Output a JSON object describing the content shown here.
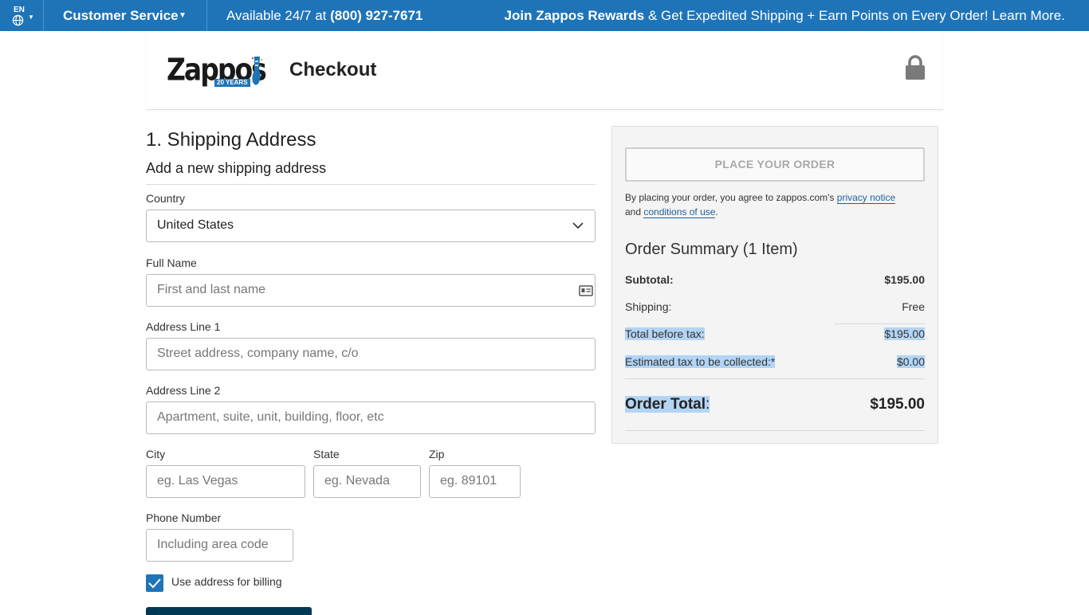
{
  "topbar": {
    "lang_code": "EN",
    "customer_service": "Customer Service",
    "available_prefix": "Available 24/7 at ",
    "phone": "(800) 927-7671",
    "rewards_bold": "Join Zappos Rewards",
    "rewards_rest": " & Get Expedited Shipping + Earn Points on Every Order! Learn More."
  },
  "header": {
    "logo_text": "Zappos",
    "logo_badge": "20 YEARS",
    "title": "Checkout"
  },
  "form": {
    "section_title": "1. Shipping Address",
    "subtitle": "Add a new shipping address",
    "country_label": "Country",
    "country_value": "United States",
    "fullname_label": "Full Name",
    "fullname_placeholder": "First and last name",
    "address1_label": "Address Line 1",
    "address1_placeholder": "Street address, company name, c/o",
    "address2_label": "Address Line 2",
    "address2_placeholder": "Apartment, suite, unit, building, floor, etc",
    "city_label": "City",
    "city_placeholder": "eg. Las Vegas",
    "state_label": "State",
    "state_placeholder": "eg. Nevada",
    "zip_label": "Zip",
    "zip_placeholder": "eg. 89101",
    "phone_label": "Phone Number",
    "phone_placeholder": "Including area code",
    "billing_checkbox_label": "Use address for billing",
    "billing_checked": true
  },
  "summary": {
    "place_order": "PLACE YOUR ORDER",
    "agree_text": "By placing your order, you agree to zappos.com's ",
    "privacy_link": "privacy notice",
    "agree_and": "and ",
    "conditions_link": "conditions of use",
    "agree_end": ".",
    "title": "Order Summary (1 Item)",
    "subtotal_label": "Subtotal:",
    "subtotal_value": "$195.00",
    "shipping_label": "Shipping:",
    "shipping_value": "Free",
    "before_tax_label": "Total before tax:",
    "before_tax_value": "$195.00",
    "tax_label": "Estimated tax to be collected:*",
    "tax_value": "$0.00",
    "order_total_label": "Order Total",
    "order_total_colon": ":",
    "order_total_value": "$195.00"
  },
  "colors": {
    "topbar_bg": "#1f74b8",
    "selection_highlight": "#b3d4f4",
    "checkbox": "#1f74b8"
  },
  "icons": [
    "globe-icon",
    "caret-down-icon",
    "shoe-icon",
    "lock-icon",
    "chevron-down-icon",
    "contact-card-icon",
    "checkmark-icon"
  ]
}
